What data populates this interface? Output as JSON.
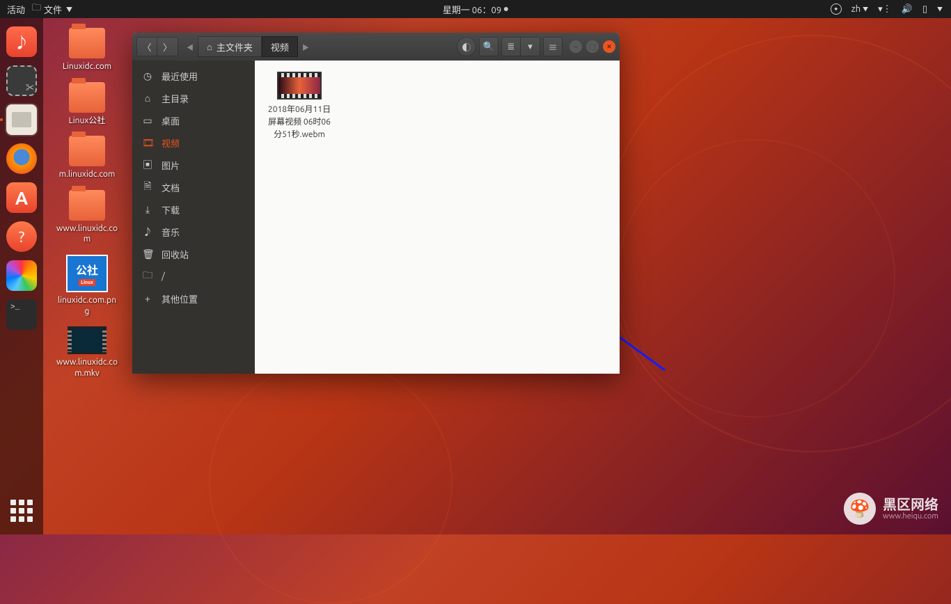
{
  "topbar": {
    "activities": "活动",
    "app_indicator": "文件",
    "datetime": "星期一 06：09",
    "lang": "zh"
  },
  "dock": {
    "software_label": "A",
    "help_label": "?",
    "term_prompt": ">_"
  },
  "desktop": {
    "folders": [
      "Linuxidc.com",
      "Linux公社",
      "m.linuxidc.com",
      "www.linuxidc.com"
    ],
    "image_file": {
      "badge": "公社",
      "sub": "Linux",
      "name": "linuxidc.com.png"
    },
    "video_file": "www.linuxidc.com.mkv"
  },
  "window": {
    "path": {
      "home_label": "主文件夹",
      "current": "视频"
    },
    "sidebar": [
      {
        "icon": "history-icon",
        "glyph": "◷",
        "label": "最近使用"
      },
      {
        "icon": "home-icon",
        "glyph": "⌂",
        "label": "主目录"
      },
      {
        "icon": "desktop-icon",
        "glyph": "▭",
        "label": "桌面"
      },
      {
        "icon": "video-icon",
        "glyph": "🎞",
        "label": "视频"
      },
      {
        "icon": "pictures-icon",
        "glyph": "▣",
        "label": "图片"
      },
      {
        "icon": "documents-icon",
        "glyph": "🗎",
        "label": "文档"
      },
      {
        "icon": "downloads-icon",
        "glyph": "⤓",
        "label": "下载"
      },
      {
        "icon": "music-icon",
        "glyph": "♪",
        "label": "音乐"
      },
      {
        "icon": "trash-icon",
        "glyph": "🗑",
        "label": "回收站"
      },
      {
        "icon": "root-icon",
        "glyph": "🗀",
        "label": "/"
      },
      {
        "icon": "other-icon",
        "glyph": "+",
        "label": "其他位置"
      }
    ],
    "sidebar_active_index": 3,
    "file": {
      "name": "2018年06月11日 屏幕视频 06时06分51秒.webm"
    }
  },
  "watermark": {
    "title": "黑区网络",
    "sub": "www.heiqu.com",
    "glyph": "🍄"
  }
}
